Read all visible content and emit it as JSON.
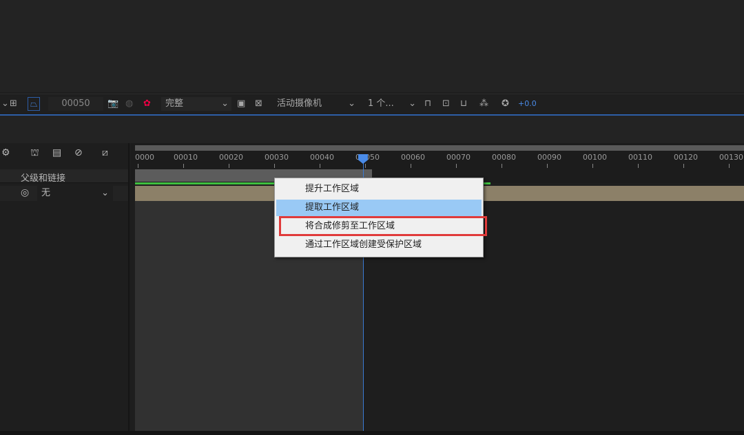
{
  "toolbar": {
    "frame_value": "00050",
    "resolution": "完整",
    "camera": "活动摄像机",
    "views": "1 个...",
    "exposure": "+0.0"
  },
  "layer_panel": {
    "parent_header": "父级和链接",
    "parent_value": "无"
  },
  "timeline": {
    "ruler_labels": [
      "0000",
      "00010",
      "00020",
      "00030",
      "00040",
      "00050",
      "00060",
      "00070",
      "00080",
      "00090",
      "00100",
      "00110",
      "00120",
      "00130"
    ],
    "current_frame": "00050"
  },
  "context_menu": {
    "items": [
      "提升工作区域",
      "提取工作区域",
      "将合成修剪至工作区域",
      "通过工作区域创建受保护区域"
    ],
    "highlighted_index": 1,
    "annotated_index": 2
  },
  "colors": {
    "accent": "#2d5ea8",
    "highlight": "#99c9f5",
    "annotation": "#e03a3a",
    "work_area_bar": "#3fbf3f"
  }
}
